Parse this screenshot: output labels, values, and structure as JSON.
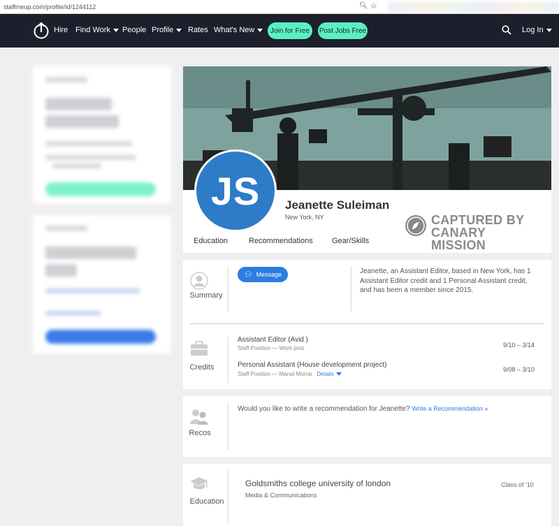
{
  "browser": {
    "url": "staffmeup.com/profile/id/1244112"
  },
  "nav": {
    "items": [
      {
        "label": "Hire"
      },
      {
        "label": "Find Work"
      },
      {
        "label": "People"
      },
      {
        "label": "Profile"
      },
      {
        "label": "Rates"
      },
      {
        "label": "What's New"
      }
    ],
    "join_label": "Join for Free",
    "post_label": "Post Jobs Free",
    "login_label": "Log In",
    "accent": "#5af0c0",
    "bg": "#1d1f2d"
  },
  "profile": {
    "initials": "JS",
    "name": "Jeanette Suleiman",
    "location": "New York, NY",
    "watermark": [
      "CAPTURED BY",
      "CANARY MISSION"
    ],
    "tabs": [
      "Education",
      "Recommendations",
      "Gear/Skills"
    ]
  },
  "summary": {
    "label": "Summary",
    "message_label": "Message",
    "text": "Jeanette, an Assistant Editor, based in New York, has 1 Assistant Editor credit and 1 Personal Assistant credit, and has been a member since 2015."
  },
  "credits": {
    "label": "Credits",
    "items": [
      {
        "title": "Assistant Editor (Avid )",
        "sub": "Staff Position — Work post",
        "dates": "9/10 – 3/14"
      },
      {
        "title": "Personal Assistant (House development project)",
        "sub": "Staff Position — Manal Morrar",
        "details": "Details",
        "dates": "9/08 – 3/10"
      }
    ]
  },
  "recos": {
    "label": "Recos",
    "text": "Would you like to write a recommendation for Jeanette?",
    "link": "Write a Recommendation »"
  },
  "education": {
    "label": "Education",
    "school": "Goldsmiths college university of london",
    "field": "Media & Communications",
    "class": "Class of '10"
  },
  "colors": {
    "link": "#2b7de1",
    "avatar": "#2e7bc8",
    "page_bg": "#efeff2"
  }
}
